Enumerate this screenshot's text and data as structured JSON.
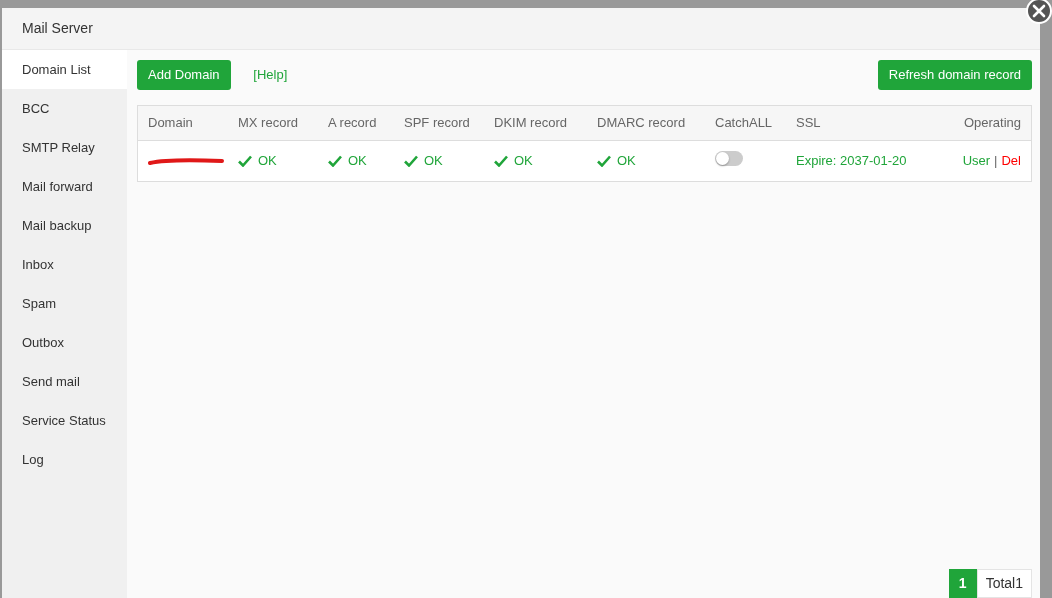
{
  "window": {
    "title": "Mail Server"
  },
  "sidebar": {
    "items": [
      {
        "label": "Domain List",
        "selected": true
      },
      {
        "label": "BCC",
        "selected": false
      },
      {
        "label": "SMTP Relay",
        "selected": false
      },
      {
        "label": "Mail forward",
        "selected": false
      },
      {
        "label": "Mail backup",
        "selected": false
      },
      {
        "label": "Inbox",
        "selected": false
      },
      {
        "label": "Spam",
        "selected": false
      },
      {
        "label": "Outbox",
        "selected": false
      },
      {
        "label": "Send mail",
        "selected": false
      },
      {
        "label": "Service Status",
        "selected": false
      },
      {
        "label": "Log",
        "selected": false
      }
    ]
  },
  "toolbar": {
    "add_button": "Add Domain",
    "help_link": "[Help]",
    "refresh_button": "Refresh domain record"
  },
  "table": {
    "columns": [
      "Domain",
      "MX record",
      "A record",
      "SPF record",
      "DKIM record",
      "DMARC record",
      "CatchALL",
      "SSL",
      "Operating"
    ],
    "rows": [
      {
        "domain_redacted": true,
        "mx": "OK",
        "a": "OK",
        "spf": "OK",
        "dkim": "OK",
        "dmarc": "OK",
        "catchall": false,
        "ssl": "Expire: 2037-01-20",
        "actions": [
          "User",
          "Del"
        ],
        "action_separator": "|"
      }
    ]
  },
  "pagination": {
    "pages": [
      {
        "label": "1",
        "selected": true
      }
    ],
    "total": "Total1"
  }
}
